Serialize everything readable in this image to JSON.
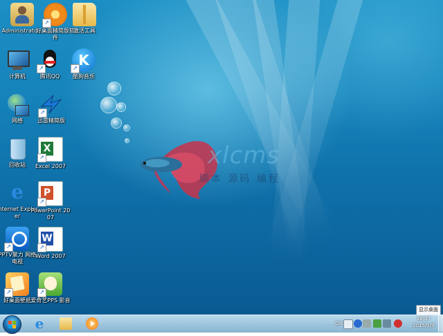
{
  "desktop": {
    "watermark_latin": "xlcms",
    "watermark_cjk": "脚本 源码 编程",
    "icons": [
      {
        "label": "Administrato..."
      },
      {
        "label": "好桌面精简版软件"
      },
      {
        "label": "激活工具"
      },
      {
        "label": "计算机"
      },
      {
        "label": "腾讯QQ"
      },
      {
        "label": "酷狗音乐"
      },
      {
        "label": "网络"
      },
      {
        "label": "迅雷精简版"
      },
      {
        "label": "回收站"
      },
      {
        "label": "Excel 2007"
      },
      {
        "label": "Internet Explorer"
      },
      {
        "label": "PowerPoint 2007"
      },
      {
        "label": "PPTV聚力 网络电视"
      },
      {
        "label": "Word 2007"
      },
      {
        "label": "好桌面壁纸"
      },
      {
        "label": "爱奇艺PPS 影音"
      }
    ]
  },
  "taskbar": {
    "pinned": [
      {
        "icon": "internet-explorer-icon"
      },
      {
        "icon": "folder-icon"
      },
      {
        "icon": "media-player-icon"
      }
    ],
    "tray": {
      "ime": "CN",
      "clock_time": "18:37",
      "clock_date": "2015/1/9",
      "show_desktop_tooltip": "显示桌面"
    }
  },
  "colors": {
    "desktop_top": "#1c8fc4",
    "desktop_bottom": "#0a5a92",
    "taskbar": "#9fc4dc"
  }
}
